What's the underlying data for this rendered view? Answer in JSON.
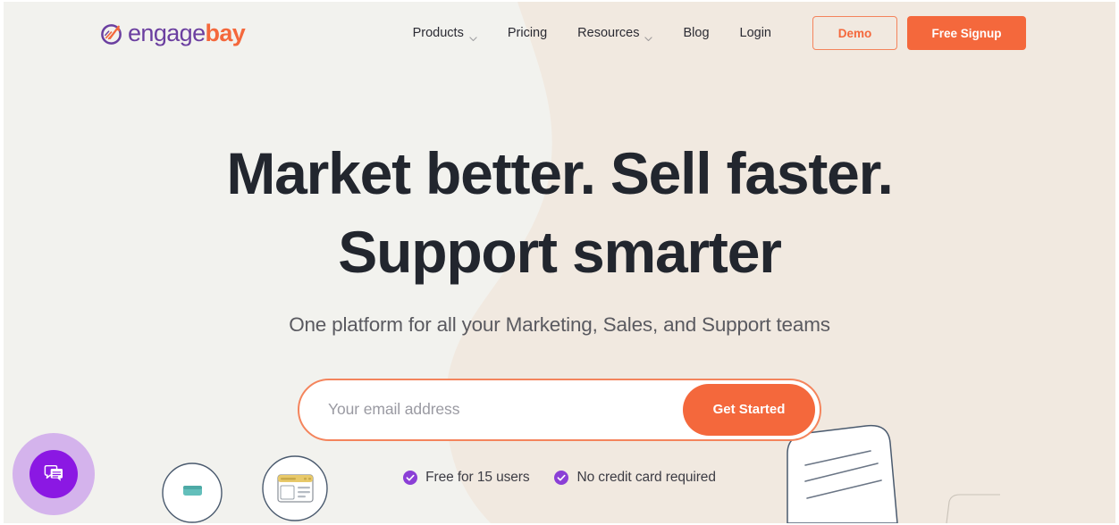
{
  "brand": {
    "name_part1": "engage",
    "name_part2": "bay",
    "logo_icon": "engagebay-circle-arrow-logo",
    "purple": "#6b3fa0",
    "orange": "#f4683c"
  },
  "header": {
    "nav": [
      {
        "label": "Products",
        "has_dropdown": true,
        "icon": "chevron-down-icon"
      },
      {
        "label": "Pricing",
        "has_dropdown": false,
        "icon": ""
      },
      {
        "label": "Resources",
        "has_dropdown": true,
        "icon": "chevron-down-icon"
      },
      {
        "label": "Blog",
        "has_dropdown": false,
        "icon": ""
      },
      {
        "label": "Login",
        "has_dropdown": false,
        "icon": ""
      }
    ],
    "demo_button": "Demo",
    "signup_button": "Free Signup"
  },
  "hero": {
    "headline_line1": "Market better. Sell faster.",
    "headline_line2": "Support smarter",
    "subheadline": "One platform for all your Marketing, Sales, and Support teams",
    "form": {
      "email_placeholder": "Your email address",
      "email_value": "",
      "submit_label": "Get Started"
    },
    "trust_badges": [
      {
        "label": "Free for 15 users",
        "icon": "check-circle-icon"
      },
      {
        "label": "No credit card required",
        "icon": "check-circle-icon"
      }
    ]
  },
  "chat_widget": {
    "icon": "chat-bubble-icon",
    "color": "#8b18e3",
    "halo_color": "#c79aec"
  },
  "background": {
    "left_color": "#f2f2ee",
    "right_color": "#f1e9e0"
  },
  "illustrations": [
    {
      "name": "circle-badge-card-icon",
      "icon": "teal-card-icon"
    },
    {
      "name": "circle-badge-browser-icon",
      "icon": "browser-window-icon"
    },
    {
      "name": "rounded-note-card",
      "icon": "note-lines-icon"
    }
  ]
}
